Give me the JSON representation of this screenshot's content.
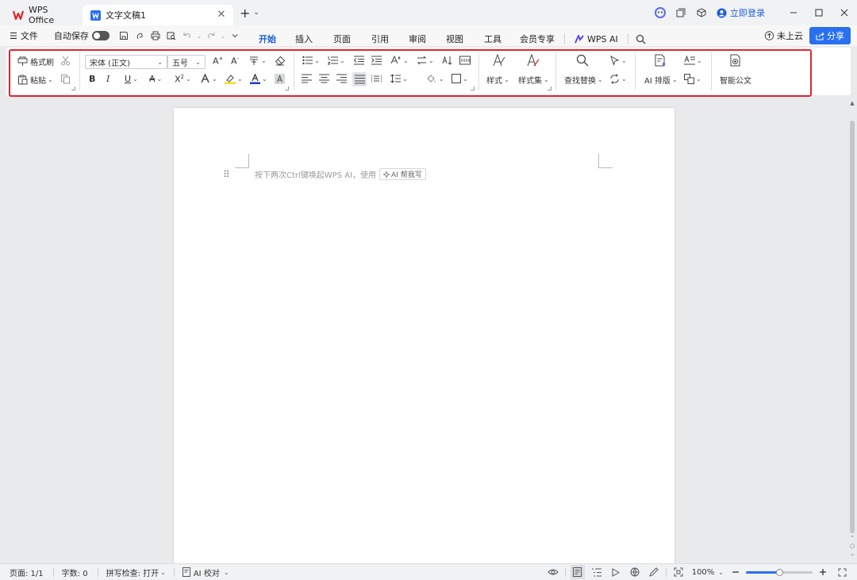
{
  "titlebar": {
    "app_tab": "WPS Office",
    "doc_tab": "文字文稿1",
    "login": "立即登录"
  },
  "menu": {
    "file": "文件",
    "autosave": "自动保存",
    "ribbon_tabs": [
      "开始",
      "插入",
      "页面",
      "引用",
      "审阅",
      "视图",
      "工具",
      "会员专享"
    ],
    "active_tab": "开始",
    "wps_ai": "WPS AI",
    "cloud": "未上云",
    "share": "分享"
  },
  "ribbon": {
    "format_painter": "格式刷",
    "paste": "粘贴",
    "font_name": "宋体 (正文)",
    "font_size": "五号",
    "styles": "样式",
    "style_set": "样式集",
    "find_replace": "查找替换",
    "ai_layout": "AI 排版",
    "smart_doc": "智能公文"
  },
  "document": {
    "placeholder": "按下两次Ctrl键唤起WPS AI，使用",
    "ai_chip": "AI 帮我写"
  },
  "status": {
    "page": "页面: 1/1",
    "words": "字数: 0",
    "spellcheck": "拼写检查: 打开",
    "ai_proof": "AI 校对",
    "zoom": "100%"
  },
  "colors": {
    "accent": "#1a5fd8",
    "highlight_border": "#e0242f",
    "font_color": "#1a3fd8",
    "highlight_color": "#f2e21a"
  }
}
